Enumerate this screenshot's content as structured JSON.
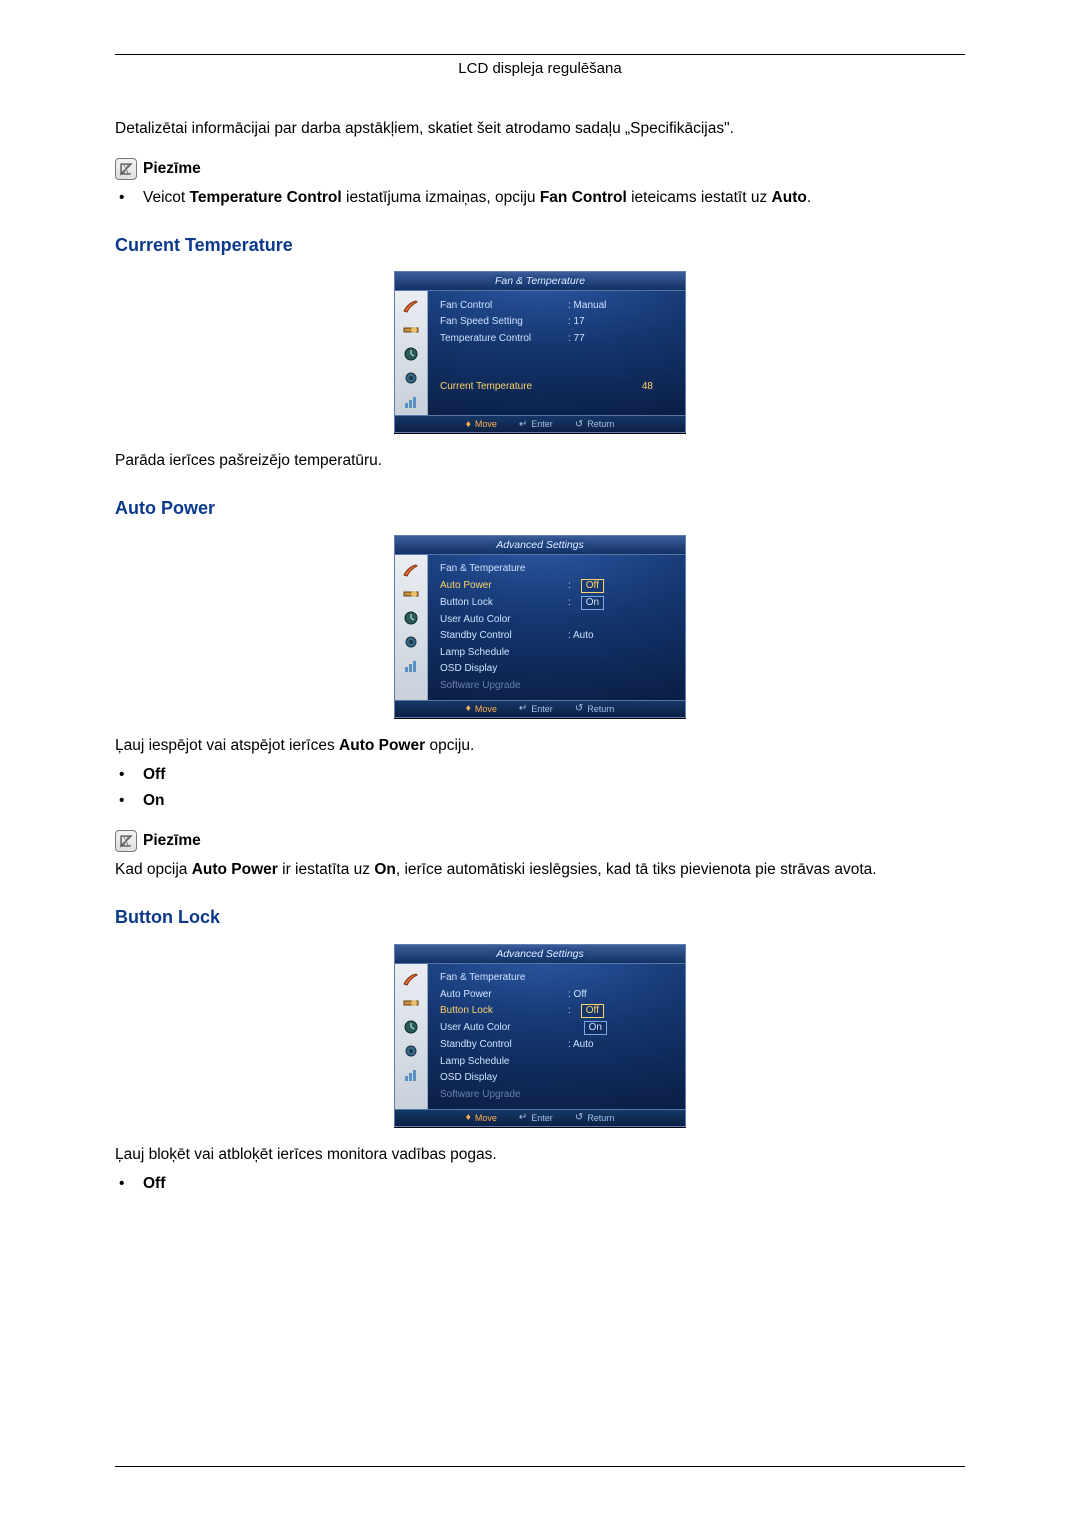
{
  "header": "LCD displeja regulēšana",
  "intro_para": "Detalizētai informācijai par darba apstākļiem, skatiet šeit atrodamo sadaļu „Specifikācijas\".",
  "note_label": "Piezīme",
  "note1_pre": "Veicot ",
  "note1_b1": "Temperature Control",
  "note1_mid": " iestatījuma izmaiņas, opciju ",
  "note1_b2": "Fan Control",
  "note1_post": " ieteicams iestatīt uz ",
  "note1_b3": "Auto",
  "note1_end": ".",
  "sections": {
    "current_temp": {
      "heading": "Current Temperature",
      "desc": "Parāda ierīces pašreizējo temperatūru."
    },
    "auto_power": {
      "heading": "Auto Power",
      "desc_pre": "Ļauj iespējot vai atspējot ierīces ",
      "desc_b": "Auto Power",
      "desc_post": " opciju.",
      "opt_off": "Off",
      "opt_on": "On",
      "note_pre": "Kad opcija ",
      "note_b1": "Auto Power",
      "note_mid": " ir iestatīta uz ",
      "note_b2": "On",
      "note_post": ", ierīce automātiski ieslēgsies, kad tā tiks pievienota pie strāvas avota."
    },
    "button_lock": {
      "heading": "Button Lock",
      "desc": "Ļauj bloķēt vai atbloķēt ierīces monitora vadības pogas.",
      "opt_off": "Off"
    }
  },
  "osd_common": {
    "footer_move": "Move",
    "footer_enter": "Enter",
    "footer_return": "Return"
  },
  "osd1": {
    "title": "Fan & Temperature",
    "rows": [
      {
        "label": "Fan Control",
        "value": ": Manual",
        "hl": false
      },
      {
        "label": "Fan Speed Setting",
        "value": ": 17",
        "hl": false
      },
      {
        "label": "Temperature Control",
        "value": ": 77",
        "hl": false
      }
    ],
    "big_label": "Current Temperature",
    "big_value": "48"
  },
  "osd2": {
    "title": "Advanced Settings",
    "rows": [
      {
        "label": "Fan & Temperature",
        "value": "",
        "style": "plain"
      },
      {
        "label": "Auto Power",
        "value": "Off",
        "style": "hl",
        "pill": true,
        "sel": true
      },
      {
        "label": "Button Lock",
        "value": "On",
        "style": "plain",
        "pill": true
      },
      {
        "label": "User Auto Color",
        "value": "",
        "style": "plain"
      },
      {
        "label": "Standby Control",
        "value": ": Auto",
        "style": "plain"
      },
      {
        "label": "Lamp Schedule",
        "value": "",
        "style": "plain"
      },
      {
        "label": "OSD Display",
        "value": "",
        "style": "plain"
      },
      {
        "label": "Software Upgrade",
        "value": "",
        "style": "dim"
      }
    ]
  },
  "osd3": {
    "title": "Advanced Settings",
    "rows": [
      {
        "label": "Fan & Temperature",
        "value": "",
        "style": "plain"
      },
      {
        "label": "Auto Power",
        "value": ": Off",
        "style": "plain"
      },
      {
        "label": "Button Lock",
        "value": "Off",
        "style": "hl",
        "pill": true,
        "sel": true
      },
      {
        "label": "User Auto Color",
        "value": "On",
        "style": "plain",
        "pill": true
      },
      {
        "label": "Standby Control",
        "value": ": Auto",
        "style": "plain"
      },
      {
        "label": "Lamp Schedule",
        "value": "",
        "style": "plain"
      },
      {
        "label": "OSD Display",
        "value": "",
        "style": "plain"
      },
      {
        "label": "Software Upgrade",
        "value": "",
        "style": "dim"
      }
    ]
  }
}
